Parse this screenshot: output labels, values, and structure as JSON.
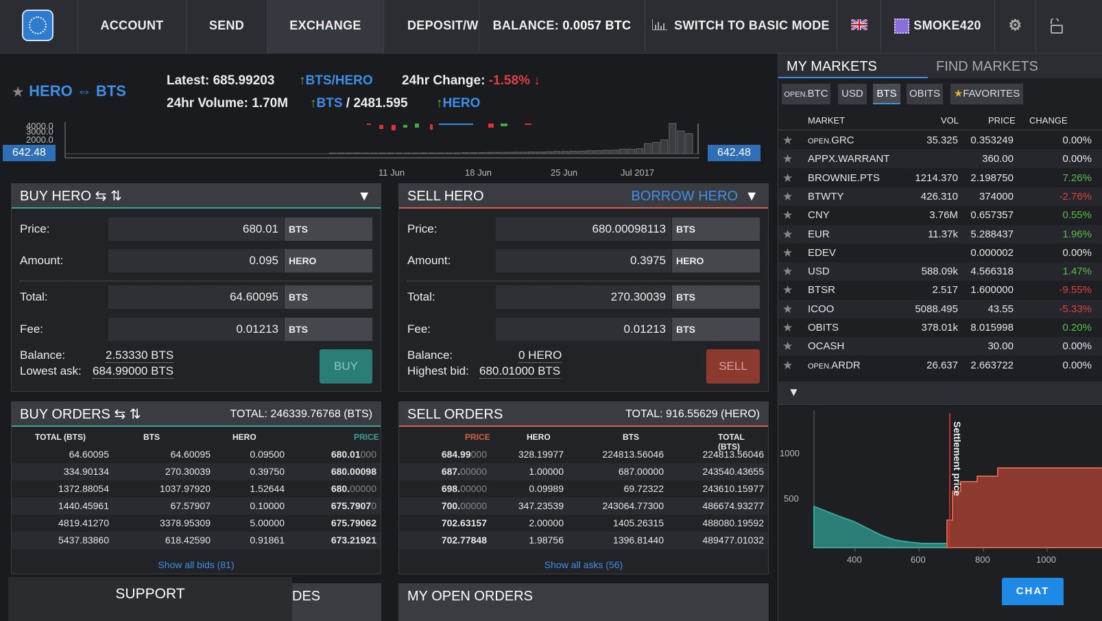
{
  "nav": {
    "account": "ACCOUNT",
    "send": "SEND",
    "exchange": "EXCHANGE",
    "deposit": "DEPOSIT/WI",
    "balance_label": "BALANCE:",
    "balance_value": "0.0057 BTC",
    "switch_mode": "SWITCH TO BASIC MODE",
    "user": "SMOKE420"
  },
  "ticker": {
    "pair": "HERO ⇔ BTS",
    "latest_label": "Latest:",
    "latest_value": "685.99203",
    "latest_pair": "BTS/HERO",
    "change_label": "24hr Change:",
    "change_value": "-1.58%",
    "volume_label": "24hr Volume:",
    "volume_value": "1.70M",
    "vol_bts_label": "BTS",
    "vol_bts_value": "/ 2481.595",
    "vol_hero_label": "HERO"
  },
  "minichart": {
    "yticks": [
      "4000.0",
      "3000.0",
      "2000.0"
    ],
    "xticks": [
      "11 Jun",
      "18 Jun",
      "25 Jun",
      "Jul 2017"
    ],
    "left_tag": "642.48",
    "right_tag": "642.48",
    "volume_bars": [
      2,
      2,
      2,
      2,
      2,
      2,
      2,
      2,
      2,
      2,
      2,
      3,
      3,
      3,
      3,
      3,
      4,
      4,
      4,
      5,
      5,
      5,
      6,
      6,
      7,
      7,
      8,
      9,
      9,
      10,
      10,
      12,
      12,
      14,
      14,
      18,
      18,
      20,
      40,
      45,
      55,
      120,
      90,
      80
    ]
  },
  "buy": {
    "title": "BUY HERO ⇆ ⇅",
    "price_label": "Price:",
    "price": "680.01",
    "price_unit": "BTS",
    "amount_label": "Amount:",
    "amount": "0.095",
    "amount_unit": "HERO",
    "total_label": "Total:",
    "total": "64.60095",
    "total_unit": "BTS",
    "fee_label": "Fee:",
    "fee": "0.01213",
    "fee_unit": "BTS",
    "balance_label": "Balance:",
    "balance": "2.53330 BTS",
    "lowest_label": "Lowest ask:",
    "lowest": "684.99000 BTS",
    "button": "BUY"
  },
  "sell": {
    "title": "SELL HERO",
    "borrow": "BORROW HERO",
    "price_label": "Price:",
    "price": "680.00098113",
    "price_unit": "BTS",
    "amount_label": "Amount:",
    "amount": "0.3975",
    "amount_unit": "HERO",
    "total_label": "Total:",
    "total": "270.30039",
    "total_unit": "BTS",
    "fee_label": "Fee:",
    "fee": "0.01213",
    "fee_unit": "BTS",
    "balance_label": "Balance:",
    "balance": "0 HERO",
    "highest_label": "Highest bid:",
    "highest": "680.01000 BTS",
    "button": "SELL"
  },
  "buy_orders": {
    "title": "BUY ORDERS ⇆ ⇅",
    "total": "TOTAL: 246339.76768 (BTS)",
    "headers": [
      "TOTAL (BTS)",
      "BTS",
      "HERO",
      "PRICE"
    ],
    "rows": [
      {
        "total": "64.60095",
        "bts": "64.60095",
        "hero": "0.09500",
        "price_b": "680.01",
        "price_d": "000"
      },
      {
        "total": "334.90134",
        "bts": "270.30039",
        "hero": "0.39750",
        "price_b": "680.00098",
        "price_d": ""
      },
      {
        "total": "1372.88054",
        "bts": "1037.97920",
        "hero": "1.52644",
        "price_b": "680.",
        "price_d": "00000"
      },
      {
        "total": "1440.45961",
        "bts": "67.57907",
        "hero": "0.10000",
        "price_b": "675.7907",
        "price_d": "0"
      },
      {
        "total": "4819.41270",
        "bts": "3378.95309",
        "hero": "5.00000",
        "price_b": "675.79062",
        "price_d": ""
      },
      {
        "total": "5437.83860",
        "bts": "618.42590",
        "hero": "0.91861",
        "price_b": "673.21921",
        "price_d": ""
      }
    ],
    "show_all": "Show all bids (81)"
  },
  "sell_orders": {
    "title": "SELL ORDERS",
    "total": "TOTAL: 916.55629 (HERO)",
    "headers": [
      "PRICE",
      "HERO",
      "BTS",
      "TOTAL (BTS)"
    ],
    "rows": [
      {
        "price_b": "684.99",
        "price_d": "000",
        "hero": "328.19977",
        "bts": "224813.56046",
        "total": "224813.56046"
      },
      {
        "price_b": "687.",
        "price_d": "00000",
        "hero": "1.00000",
        "bts": "687.00000",
        "total": "243540.43655"
      },
      {
        "price_b": "698.",
        "price_d": "00000",
        "hero": "0.09989",
        "bts": "69.72322",
        "total": "243610.15977"
      },
      {
        "price_b": "700.",
        "price_d": "00000",
        "hero": "347.23539",
        "bts": "243064.77300",
        "total": "486674.93277"
      },
      {
        "price_b": "702.63157",
        "price_d": "",
        "hero": "2.00000",
        "bts": "1405.26315",
        "total": "488080.19592"
      },
      {
        "price_b": "702.77848",
        "price_d": "",
        "hero": "1.98756",
        "bts": "1396.81440",
        "total": "489477.01032"
      }
    ],
    "show_all": "Show all asks (56)"
  },
  "bottom": {
    "support": "SUPPORT",
    "trades_partial": "DES",
    "my_open_orders": "MY OPEN ORDERS",
    "chat": "CHAT"
  },
  "markets": {
    "tab_my": "MY MARKETS",
    "tab_find": "FIND MARKETS",
    "filters": [
      "OPEN.BTC",
      "USD",
      "BTS",
      "OBITS",
      "FAVORITES"
    ],
    "headers": [
      "MARKET",
      "VOL",
      "PRICE",
      "CHANGE"
    ],
    "rows": [
      {
        "prefix": "OPEN.",
        "name": "GRC",
        "vol": "35.325",
        "price": "0.353249",
        "change": "0.00%",
        "dir": "flat"
      },
      {
        "prefix": "",
        "name": "APPX.WARRANT",
        "vol": "",
        "price": "360.00",
        "change": "0.00%",
        "dir": "flat"
      },
      {
        "prefix": "",
        "name": "BROWNIE.PTS",
        "vol": "1214.370",
        "price": "2.198750",
        "change": "7.26%",
        "dir": "up"
      },
      {
        "prefix": "",
        "name": "BTWTY",
        "vol": "426.310",
        "price": "374000",
        "change": "-2.76%",
        "dir": "down"
      },
      {
        "prefix": "",
        "name": "CNY",
        "vol": "3.76M",
        "price": "0.657357",
        "change": "0.55%",
        "dir": "up"
      },
      {
        "prefix": "",
        "name": "EUR",
        "vol": "11.37k",
        "price": "5.288437",
        "change": "1.96%",
        "dir": "up"
      },
      {
        "prefix": "",
        "name": "EDEV",
        "vol": "",
        "price": "0.000002",
        "change": "0.00%",
        "dir": "flat"
      },
      {
        "prefix": "",
        "name": "USD",
        "vol": "588.09k",
        "price": "4.566318",
        "change": "1.47%",
        "dir": "up"
      },
      {
        "prefix": "",
        "name": "BTSR",
        "vol": "2.517",
        "price": "1.600000",
        "change": "-9.55%",
        "dir": "down"
      },
      {
        "prefix": "",
        "name": "ICOO",
        "vol": "5088.495",
        "price": "43.55",
        "change": "-5.33%",
        "dir": "down"
      },
      {
        "prefix": "",
        "name": "OBITS",
        "vol": "378.01k",
        "price": "8.015998",
        "change": "0.20%",
        "dir": "up"
      },
      {
        "prefix": "",
        "name": "OCASH",
        "vol": "",
        "price": "30.00",
        "change": "0.00%",
        "dir": "flat"
      },
      {
        "prefix": "OPEN.",
        "name": "ARDR",
        "vol": "26.637",
        "price": "2.663722",
        "change": "0.00%",
        "dir": "flat"
      }
    ]
  },
  "depth": {
    "yticks": [
      "1000",
      "500"
    ],
    "xticks": [
      "400",
      "600",
      "800",
      "1000"
    ],
    "settlement": "Settlement price"
  },
  "colors": {
    "accent": "#3d8fe8",
    "buy": "#2b7e76",
    "sell": "#8c3a2f",
    "up": "#5cbc4c",
    "down": "#e04040"
  }
}
